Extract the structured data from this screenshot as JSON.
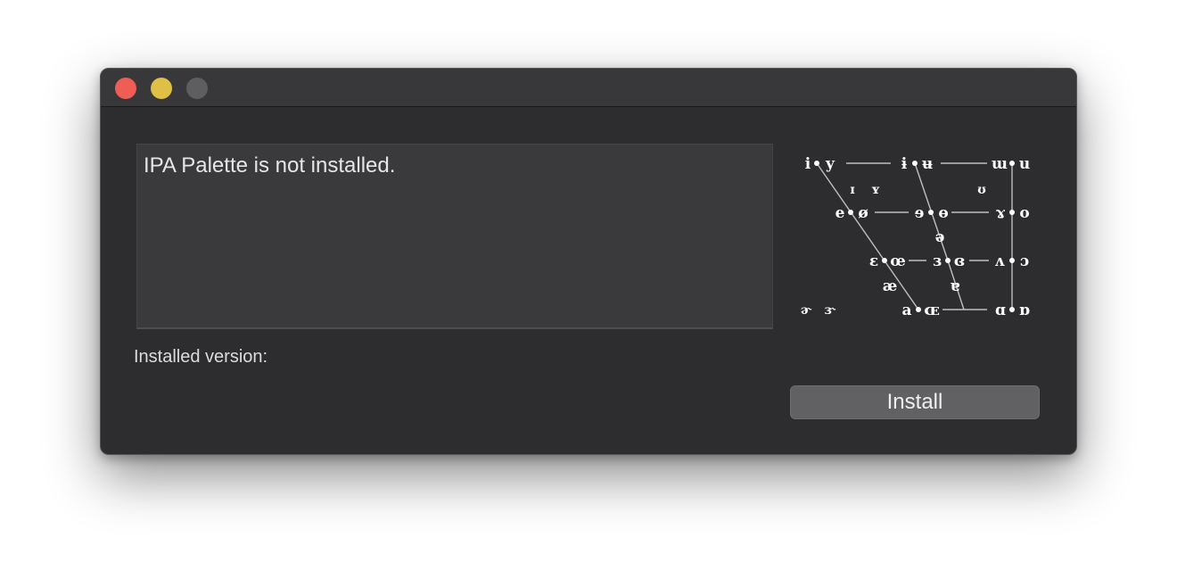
{
  "window": {
    "controls": {
      "close": "close-button",
      "minimize": "minimize-button",
      "zoom": "zoom-button"
    }
  },
  "message": "IPA Palette is not installed.",
  "installed_version_label": "Installed version:",
  "install_button_label": "Install",
  "vowel_chart": {
    "close_front_unrounded": "i",
    "close_front_rounded": "y",
    "close_central_unrounded": "ɨ",
    "close_central_rounded": "ʉ",
    "close_back_unrounded": "ɯ",
    "close_back_rounded": "u",
    "near_close_front_unrounded": "ɪ",
    "near_close_front_rounded": "ʏ",
    "near_close_back_rounded": "ʊ",
    "close_mid_front_unrounded": "e",
    "close_mid_front_rounded": "ø",
    "close_mid_central_unrounded": "ɘ",
    "close_mid_central_rounded": "ɵ",
    "close_mid_back_unrounded": "ɤ",
    "close_mid_back_rounded": "o",
    "mid_central": "ə",
    "open_mid_front_unrounded": "ɛ",
    "open_mid_front_rounded": "œ",
    "open_mid_central_unrounded": "ɜ",
    "open_mid_central_rounded": "ɞ",
    "open_mid_back_unrounded": "ʌ",
    "open_mid_back_rounded": "ɔ",
    "near_open_front_unrounded": "æ",
    "near_open_central": "ɐ",
    "open_front_unrounded": "a",
    "open_front_rounded": "ɶ",
    "open_back_unrounded": "ɑ",
    "open_back_rounded": "ɒ",
    "rhotic_schwa": "ɚ",
    "rhotic_open_mid_central": "ɝ"
  }
}
